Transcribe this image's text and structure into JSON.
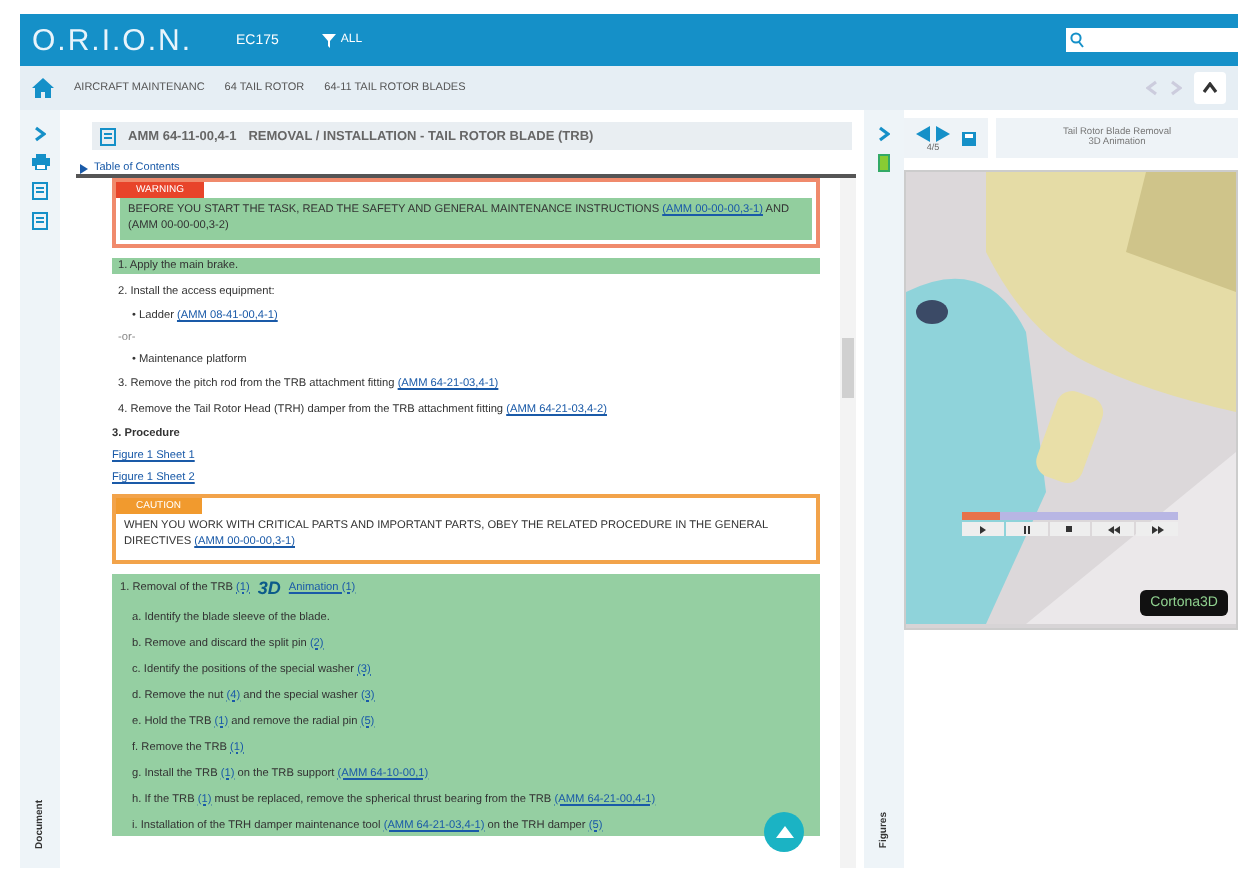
{
  "topbar": {
    "logo": "O.R.I.O.N.",
    "model": "EC175",
    "filter": "ALL"
  },
  "breadcrumb": {
    "items": [
      "AIRCRAFT MAINTENANC",
      "64 TAIL ROTOR",
      "64-11 TAIL ROTOR BLADES"
    ]
  },
  "document": {
    "code": "AMM 64-11-00,4-1",
    "title": "REMOVAL / INSTALLATION - TAIL ROTOR BLADE (TRB)",
    "toc": "Table of Contents",
    "items": [
      {
        "kind": "warning",
        "label": "WARNING",
        "parts": [
          {
            "t": "BEFORE YOU START THE TASK, READ THE SAFETY AND GENERAL MAINTENANCE INSTRUCTIONS "
          },
          {
            "link": "(AMM 00-00-00,3-1)"
          },
          {
            "t": " AND (AMM 00-00-00,3-2)"
          }
        ]
      },
      {
        "kind": "step",
        "highlighted": true,
        "parts": [
          {
            "t": "1. Apply the main brake."
          }
        ]
      },
      {
        "kind": "step",
        "highlighted": false,
        "parts": [
          {
            "t": "2. Install the access equipment:"
          }
        ]
      },
      {
        "kind": "bullet",
        "parts": [
          {
            "t": "• Ladder "
          },
          {
            "link": "(AMM 08-41-00,4-1)"
          }
        ]
      },
      {
        "kind": "or",
        "parts": [
          {
            "t": "-or-"
          }
        ]
      },
      {
        "kind": "bullet",
        "parts": [
          {
            "t": "• Maintenance platform"
          }
        ]
      },
      {
        "kind": "step",
        "highlighted": false,
        "parts": [
          {
            "t": "3. Remove the pitch rod from the TRB attachment fitting "
          },
          {
            "link": "(AMM 64-21-03,4-1)"
          }
        ]
      },
      {
        "kind": "step",
        "highlighted": false,
        "parts": [
          {
            "t": "4. Remove the Tail Rotor Head (TRH) damper from the TRB attachment fitting "
          },
          {
            "link": "(AMM 64-21-03,4-2)"
          }
        ]
      },
      {
        "kind": "heading",
        "parts": [
          {
            "t": "3. Procedure"
          }
        ]
      },
      {
        "kind": "figure",
        "parts": [
          {
            "link": "Figure 1 Sheet 1"
          }
        ]
      },
      {
        "kind": "figure",
        "parts": [
          {
            "link": "Figure 1 Sheet 2"
          }
        ]
      },
      {
        "kind": "caution",
        "label": "CAUTION",
        "parts": [
          {
            "t": "WHEN YOU WORK WITH CRITICAL PARTS AND IMPORTANT PARTS, OBEY THE RELATED PROCEDURE IN THE GENERAL DIRECTIVES "
          },
          {
            "link": "(AMM 00-00-00,3-1)"
          }
        ]
      },
      {
        "kind": "task",
        "parts": [
          {
            "t": "1. Removal of the TRB "
          },
          {
            "link": "(1)"
          }
        ],
        "badge": "3D",
        "animation": "Animation (1)",
        "substeps": [
          [
            {
              "t": "a. Identify the blade sleeve of the blade."
            }
          ],
          [
            {
              "t": "b. Remove and discard the split pin "
            },
            {
              "link": "(2)"
            }
          ],
          [
            {
              "t": "c. Identify the positions of the special washer "
            },
            {
              "link": "(3)"
            }
          ],
          [
            {
              "t": "d. Remove the nut "
            },
            {
              "link": "(4)"
            },
            {
              "t": " and the special washer "
            },
            {
              "link": "(3)"
            }
          ],
          [
            {
              "t": "e. Hold the TRB "
            },
            {
              "link": "(1)"
            },
            {
              "t": " and remove the radial pin "
            },
            {
              "link": "(5)"
            }
          ],
          [
            {
              "t": "f. Remove the TRB "
            },
            {
              "link": "(1)"
            }
          ],
          [
            {
              "t": "g. Install the TRB "
            },
            {
              "link": "(1)"
            },
            {
              "t": " on the TRB support "
            },
            {
              "link": "(AMM 64-10-00,1)"
            }
          ],
          [
            {
              "t": "h. If the TRB "
            },
            {
              "link": "(1)"
            },
            {
              "t": " must be replaced, remove the spherical thrust bearing from the TRB "
            },
            {
              "link": "(AMM 64-21-00,4-1)"
            }
          ],
          [
            {
              "t": "i. Installation of the TRH damper maintenance tool "
            },
            {
              "link": "(AMM 64-21-03,4-1)"
            },
            {
              "t": " on the TRH damper "
            },
            {
              "link": "(5)"
            }
          ]
        ]
      }
    ]
  },
  "left_strip": {
    "label": "Document"
  },
  "middle_strip": {
    "label": "Figures"
  },
  "figure_panel": {
    "counter": "4/5",
    "title": "Tail Rotor Blade Removal",
    "subtitle": "3D Animation",
    "timeline": {
      "level": 0.18
    },
    "brand": "Cortona3D"
  }
}
